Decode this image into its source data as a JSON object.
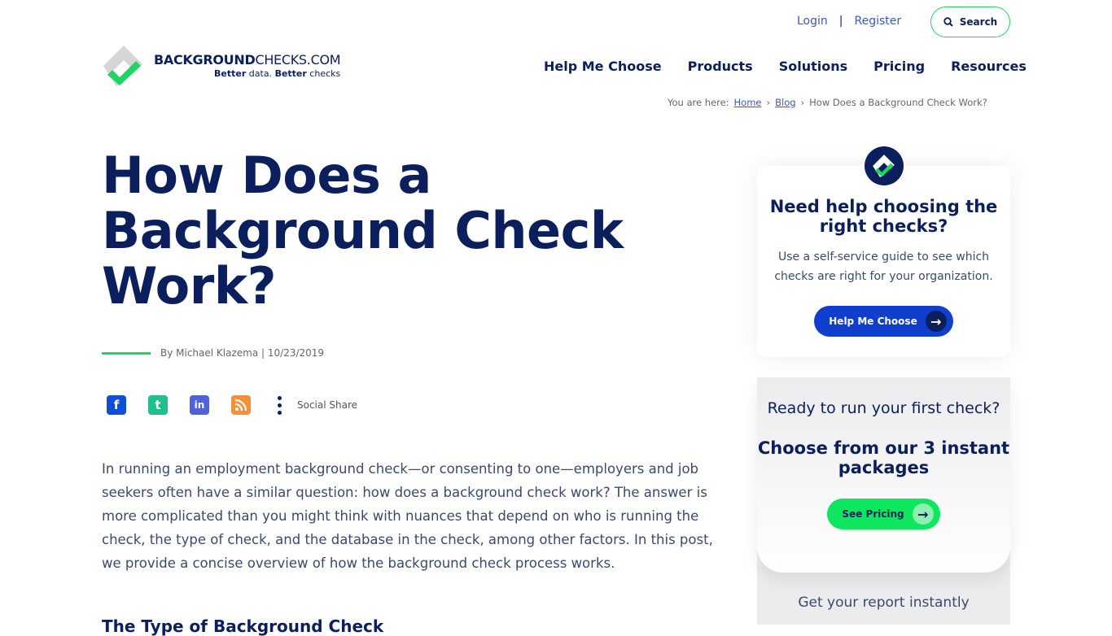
{
  "header": {
    "login": "Login",
    "register": "Register",
    "search": "Search",
    "logo": {
      "main_bold": "BACKGROUND",
      "main_light": "CHECKS.COM",
      "tag_bold1": "Better",
      "tag_light1": " data. ",
      "tag_bold2": "Better",
      "tag_light2": " checks"
    },
    "nav": [
      "Help Me Choose",
      "Products",
      "Solutions",
      "Pricing",
      "Resources"
    ]
  },
  "breadcrumb": {
    "prefix": "You are here:",
    "home": "Home",
    "blog": "Blog",
    "current": "How Does a Background Check Work?",
    "sep": "›"
  },
  "article": {
    "title": "How Does a Background Check Work?",
    "byline": "By Michael Klazema | 10/23/2019",
    "social": {
      "icons": [
        "facebook-icon",
        "twitter-icon",
        "linkedin-icon",
        "rss-icon"
      ],
      "label": "Social Share"
    },
    "intro": "In running an employment background check—or consenting to one—employers and job seekers often have a similar question: how does a background check work? The answer is more complicated than you might think with nuances that depend on who is running the check, the type of check, and the database in the check, among other factors. In this post, we provide a concise overview of how the background check process works.",
    "subhead": "The Type of Background Check"
  },
  "sidebar": {
    "help": {
      "title": "Need help choosing the right checks?",
      "text": "Use a self-service guide to see which checks are right for your organization.",
      "button": "Help Me Choose"
    },
    "pricing": {
      "question": "Ready to run your first check?",
      "title": "Choose from our 3 instant packages",
      "button": "See Pricing"
    },
    "instant": "Get your report instantly"
  },
  "colors": {
    "navy": "#0a1f5c",
    "green": "#1fd463",
    "blue": "#0f3fcc",
    "link": "#3c56c8"
  }
}
